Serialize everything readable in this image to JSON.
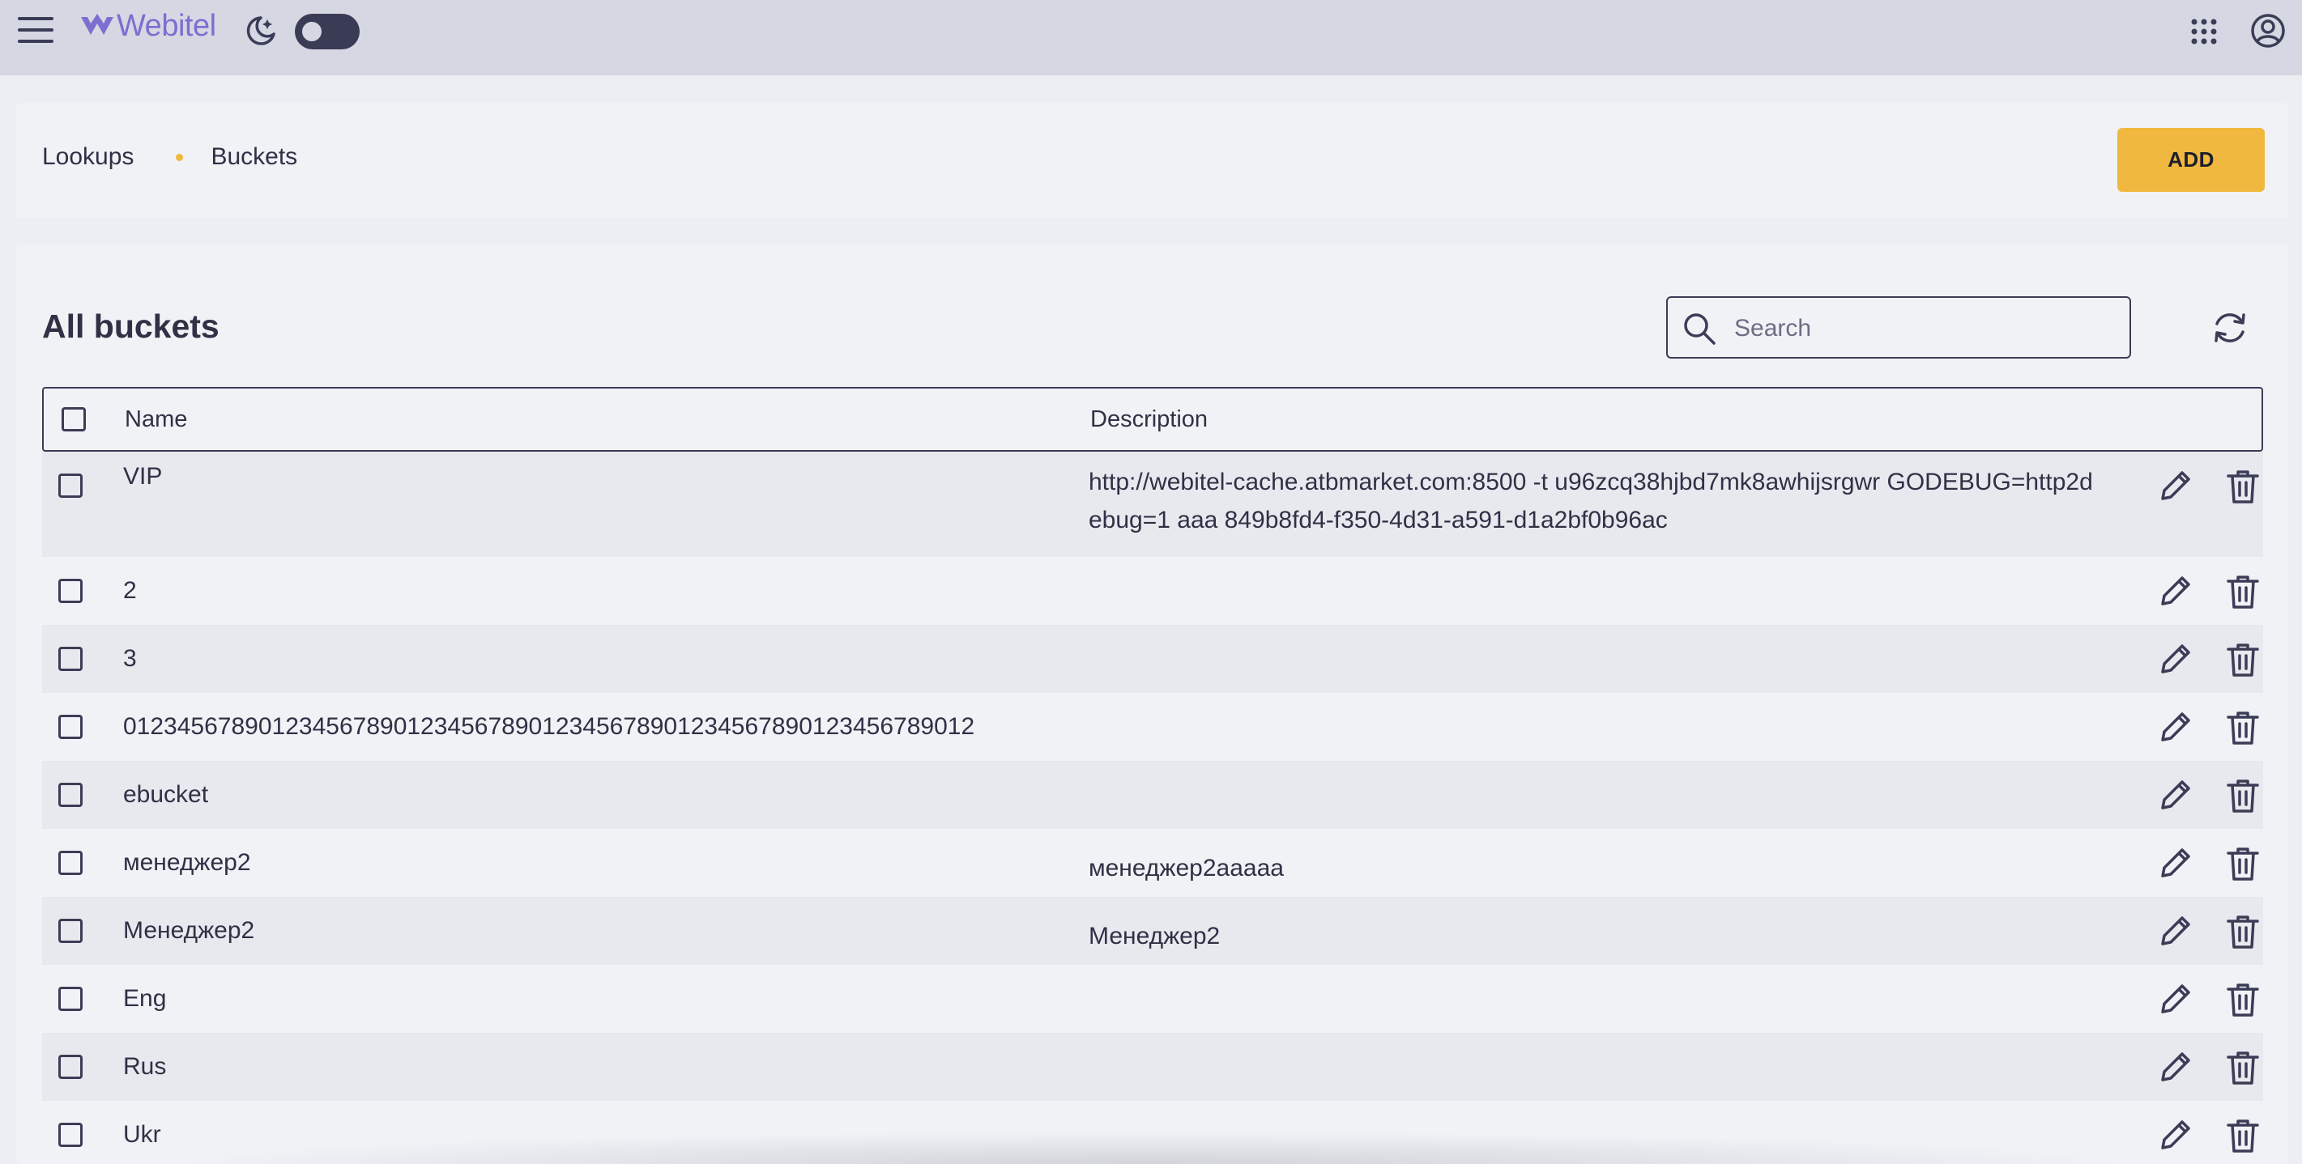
{
  "app": {
    "logo_text": "Webitel",
    "theme_toggle": "off"
  },
  "breadcrumb": {
    "items": [
      "Lookups",
      "Buckets"
    ]
  },
  "header": {
    "add_label": "ADD"
  },
  "main": {
    "title": "All buckets",
    "search": {
      "placeholder": "Search",
      "value": ""
    },
    "table": {
      "columns": {
        "name": "Name",
        "description": "Description"
      },
      "rows": [
        {
          "name": "VIP",
          "description": "http://webitel-cache.atbmarket.com:8500 -t u96zcq38hjbd7mk8awhijsrgwr GODEBUG=http2debug=1 aaa 849b8fd4-f350-4d31-a591-d1a2bf0b96ac"
        },
        {
          "name": "2",
          "description": ""
        },
        {
          "name": "3",
          "description": ""
        },
        {
          "name": "012345678901234567890123456789012345678901234567890123456789012",
          "description": ""
        },
        {
          "name": "ebucket",
          "description": ""
        },
        {
          "name": "менеджер2",
          "description": "менеджер2ааааа"
        },
        {
          "name": "Менеджер2",
          "description": "Менеджер2"
        },
        {
          "name": "Eng",
          "description": ""
        },
        {
          "name": "Rus",
          "description": ""
        },
        {
          "name": "Ukr",
          "description": ""
        }
      ]
    }
  },
  "colors": {
    "topbar": "#d5d7e2",
    "accent": "#f0b83e",
    "text": "#2f3145",
    "logo": "#7b6fd0"
  }
}
